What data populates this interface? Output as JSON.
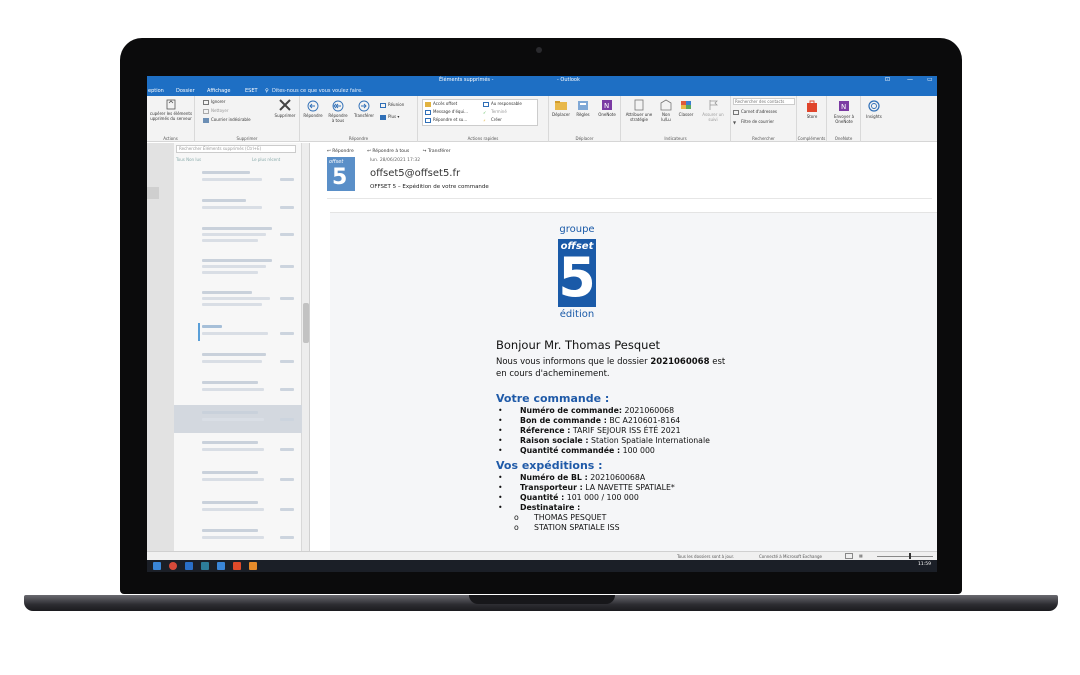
{
  "window": {
    "title": "Éléments supprimés -",
    "app": "- Outlook",
    "controls": [
      "⊡",
      "—",
      "▭"
    ]
  },
  "menu": {
    "items": [
      "eption",
      "Dossier",
      "Affichage",
      "ESET"
    ],
    "tell_me": "Dites-nous ce que vous voulez faire."
  },
  "ribbon": {
    "actions": {
      "button": "cupérer les éléments\nupprimés du serveur",
      "group": "Actions"
    },
    "supprimer": {
      "ignorer": "Ignorer",
      "nettoyer": "Nettoyer",
      "courrier": "Courrier indésirable",
      "supprimer": "Supprimer",
      "group": "Supprimer"
    },
    "repondre": {
      "repondre": "Répondre",
      "repondre_tous": "Répondre\nà tous",
      "transferer": "Transférer",
      "reunion": "Réunion",
      "plus": "Plus",
      "group": "Répondre"
    },
    "actions_rapides": {
      "items": [
        "Accès offset",
        "Message d'équi...",
        "Répondre et su...",
        "Au responsable",
        "Terminé",
        "Créer"
      ],
      "group": "Actions rapides"
    },
    "deplacer": {
      "deplacer": "Déplacer",
      "regles": "Règles",
      "onenote": "OneNote",
      "group": "Déplacer"
    },
    "indicateurs": {
      "attribuer": "Attribuer une\nstratégie",
      "non_lu": "Non\nlu/Lu",
      "classer": "Classer",
      "assurer": "Assurer un\nsuivi",
      "group": "Indicateurs"
    },
    "rechercher": {
      "placeholder": "Rechercher des contacts",
      "carnet": "Carnet d'adresses",
      "filtre": "Filtre de courrier",
      "group": "Rechercher"
    },
    "complements": {
      "store": "Store",
      "group": "Compléments"
    },
    "onenote": {
      "envoyer": "Envoyer à\nOneNote",
      "group": "OneNote"
    },
    "insights": {
      "label": "Insights"
    }
  },
  "folder_pane": {
    "search_placeholder": "Rechercher Éléments supprimés (Ctrl+E)",
    "filter": "Tous   Non lus",
    "sort": "Le plus récent"
  },
  "reading_pane": {
    "actions": [
      "Répondre",
      "Répondre à tous",
      "Transférer"
    ],
    "date": "lun. 28/06/2021 17:32",
    "sender": "offset5@offset5.fr",
    "subject": "OFFSET 5 – Expédition de votre commande",
    "avatar_text": "offset",
    "avatar_number": "5"
  },
  "message": {
    "logo": {
      "top": "groupe",
      "middle": "offset",
      "number": "5",
      "bottom": "édition"
    },
    "greeting": "Bonjour Mr. Thomas Pesquet",
    "intro_prefix": "Nous vous informons que le dossier ",
    "dossier": "2021060068",
    "intro_suffix": " est",
    "intro_line2": "en cours d'acheminement.",
    "commande_title": "Votre commande :",
    "commande": [
      {
        "label": "Numéro de commande:",
        "value": " 2021060068"
      },
      {
        "label": "Bon de commande :",
        "value": " BC A210601-8164"
      },
      {
        "label": "Réference :",
        "value": " TARIF SEJOUR ISS ÉTÉ 2021"
      },
      {
        "label": "Raison sociale :",
        "value": " Station Spatiale Internationale"
      },
      {
        "label": "Quantité commandée :",
        "value": " 100 000"
      }
    ],
    "expeditions_title": "Vos expéditions :",
    "expeditions": [
      {
        "label": "Numéro de BL :",
        "value": " 2021060068A"
      },
      {
        "label": "Transporteur :",
        "value": " LA NAVETTE SPATIALE*"
      },
      {
        "label": "Quantité :",
        "value": " 101 000 / 100 000"
      },
      {
        "label": "Destinataire :",
        "value": ""
      }
    ],
    "destinataire": [
      "THOMAS PESQUET",
      "STATION SPATIALE ISS"
    ],
    "bullet": "•",
    "sub_bullet": "o"
  },
  "status_bar": {
    "left": "Tous les dossiers sont à jour.",
    "right": "Connecté à Microsoft Exchange"
  },
  "taskbar": {
    "clock": "11:59"
  },
  "colors": {
    "accent": "#1e6fc4",
    "brand": "#1a5aa8"
  }
}
